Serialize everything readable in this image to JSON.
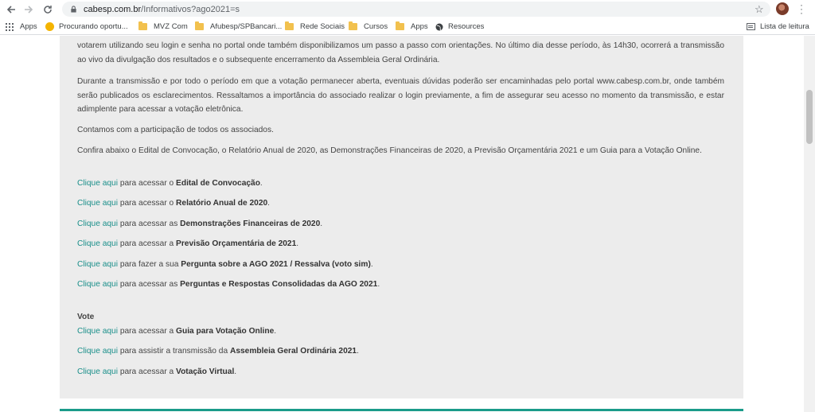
{
  "browser": {
    "url_host": "cabesp.com.br",
    "url_path": "/Informativos?ago2021=s",
    "bookmarks": [
      {
        "label": "Apps",
        "icon": "apps-grid-icon"
      },
      {
        "label": "Procurando oportu...",
        "icon": "yellow-circle-icon"
      },
      {
        "label": "MVZ Com",
        "icon": "folder-icon"
      },
      {
        "label": "Afubesp/SPBancari...",
        "icon": "folder-icon"
      },
      {
        "label": "Rede Sociais",
        "icon": "folder-icon"
      },
      {
        "label": "Cursos",
        "icon": "folder-icon"
      },
      {
        "label": "Apps",
        "icon": "folder-icon"
      },
      {
        "label": "Resources",
        "icon": "globe-icon"
      }
    ],
    "reading_list": "Lista de leitura"
  },
  "content": {
    "p1": "votarem utilizando seu login e senha no portal onde também disponibilizamos um passo a passo com orientações. No último dia desse período, às 14h30, ocorrerá a transmissão ao vivo da divulgação dos resultados e o subsequente encerramento da Assembleia Geral Ordinária.",
    "p2": "Durante a transmissão e por todo o período em que a votação permanecer aberta, eventuais dúvidas poderão ser encaminhadas pelo portal www.cabesp.com.br, onde também serão publicados os esclarecimentos. Ressaltamos a importância do associado realizar o login previamente, a fim de assegurar seu acesso no momento da transmissão, e estar adimplente para acessar a votação eletrônica.",
    "p3": "Contamos com a participação de todos os associados.",
    "p4": "Confira abaixo o Edital de Convocação, o Relatório Anual de 2020, as Demonstrações Financeiras de 2020, a Previsão Orçamentária 2021 e um Guia para a Votação Online.",
    "link_text": "Clique aqui",
    "links": [
      {
        "pre": " para acessar o ",
        "bold": "Edital de Convocação",
        "post": "."
      },
      {
        "pre": " para acessar o ",
        "bold": "Relatório Anual de 2020",
        "post": "."
      },
      {
        "pre": " para acessar as ",
        "bold": "Demonstrações Financeiras de 2020",
        "post": "."
      },
      {
        "pre": " para acessar a ",
        "bold": "Previsão Orçamentária de 2021",
        "post": "."
      },
      {
        "pre": " para fazer a sua ",
        "bold": "Pergunta sobre a AGO 2021 / Ressalva (voto sim)",
        "post": "."
      },
      {
        "pre": " para acessar as ",
        "bold": "Perguntas e Respostas Consolidadas da AGO 2021",
        "post": "."
      }
    ],
    "vote_heading": "Vote",
    "vote_links": [
      {
        "pre": " para acessar a ",
        "bold": "Guia para Votação Online",
        "post": "."
      },
      {
        "pre": " para assistir a transmissão da ",
        "bold": "Assembleia Geral Ordinária 2021",
        "post": "."
      },
      {
        "pre": " para acessar a ",
        "bold": "Votação Virtual",
        "post": "."
      }
    ]
  },
  "colors": {
    "link": "#1a8f8a",
    "box_bg": "#ececec",
    "accent_bar": "#1a9b8a"
  }
}
